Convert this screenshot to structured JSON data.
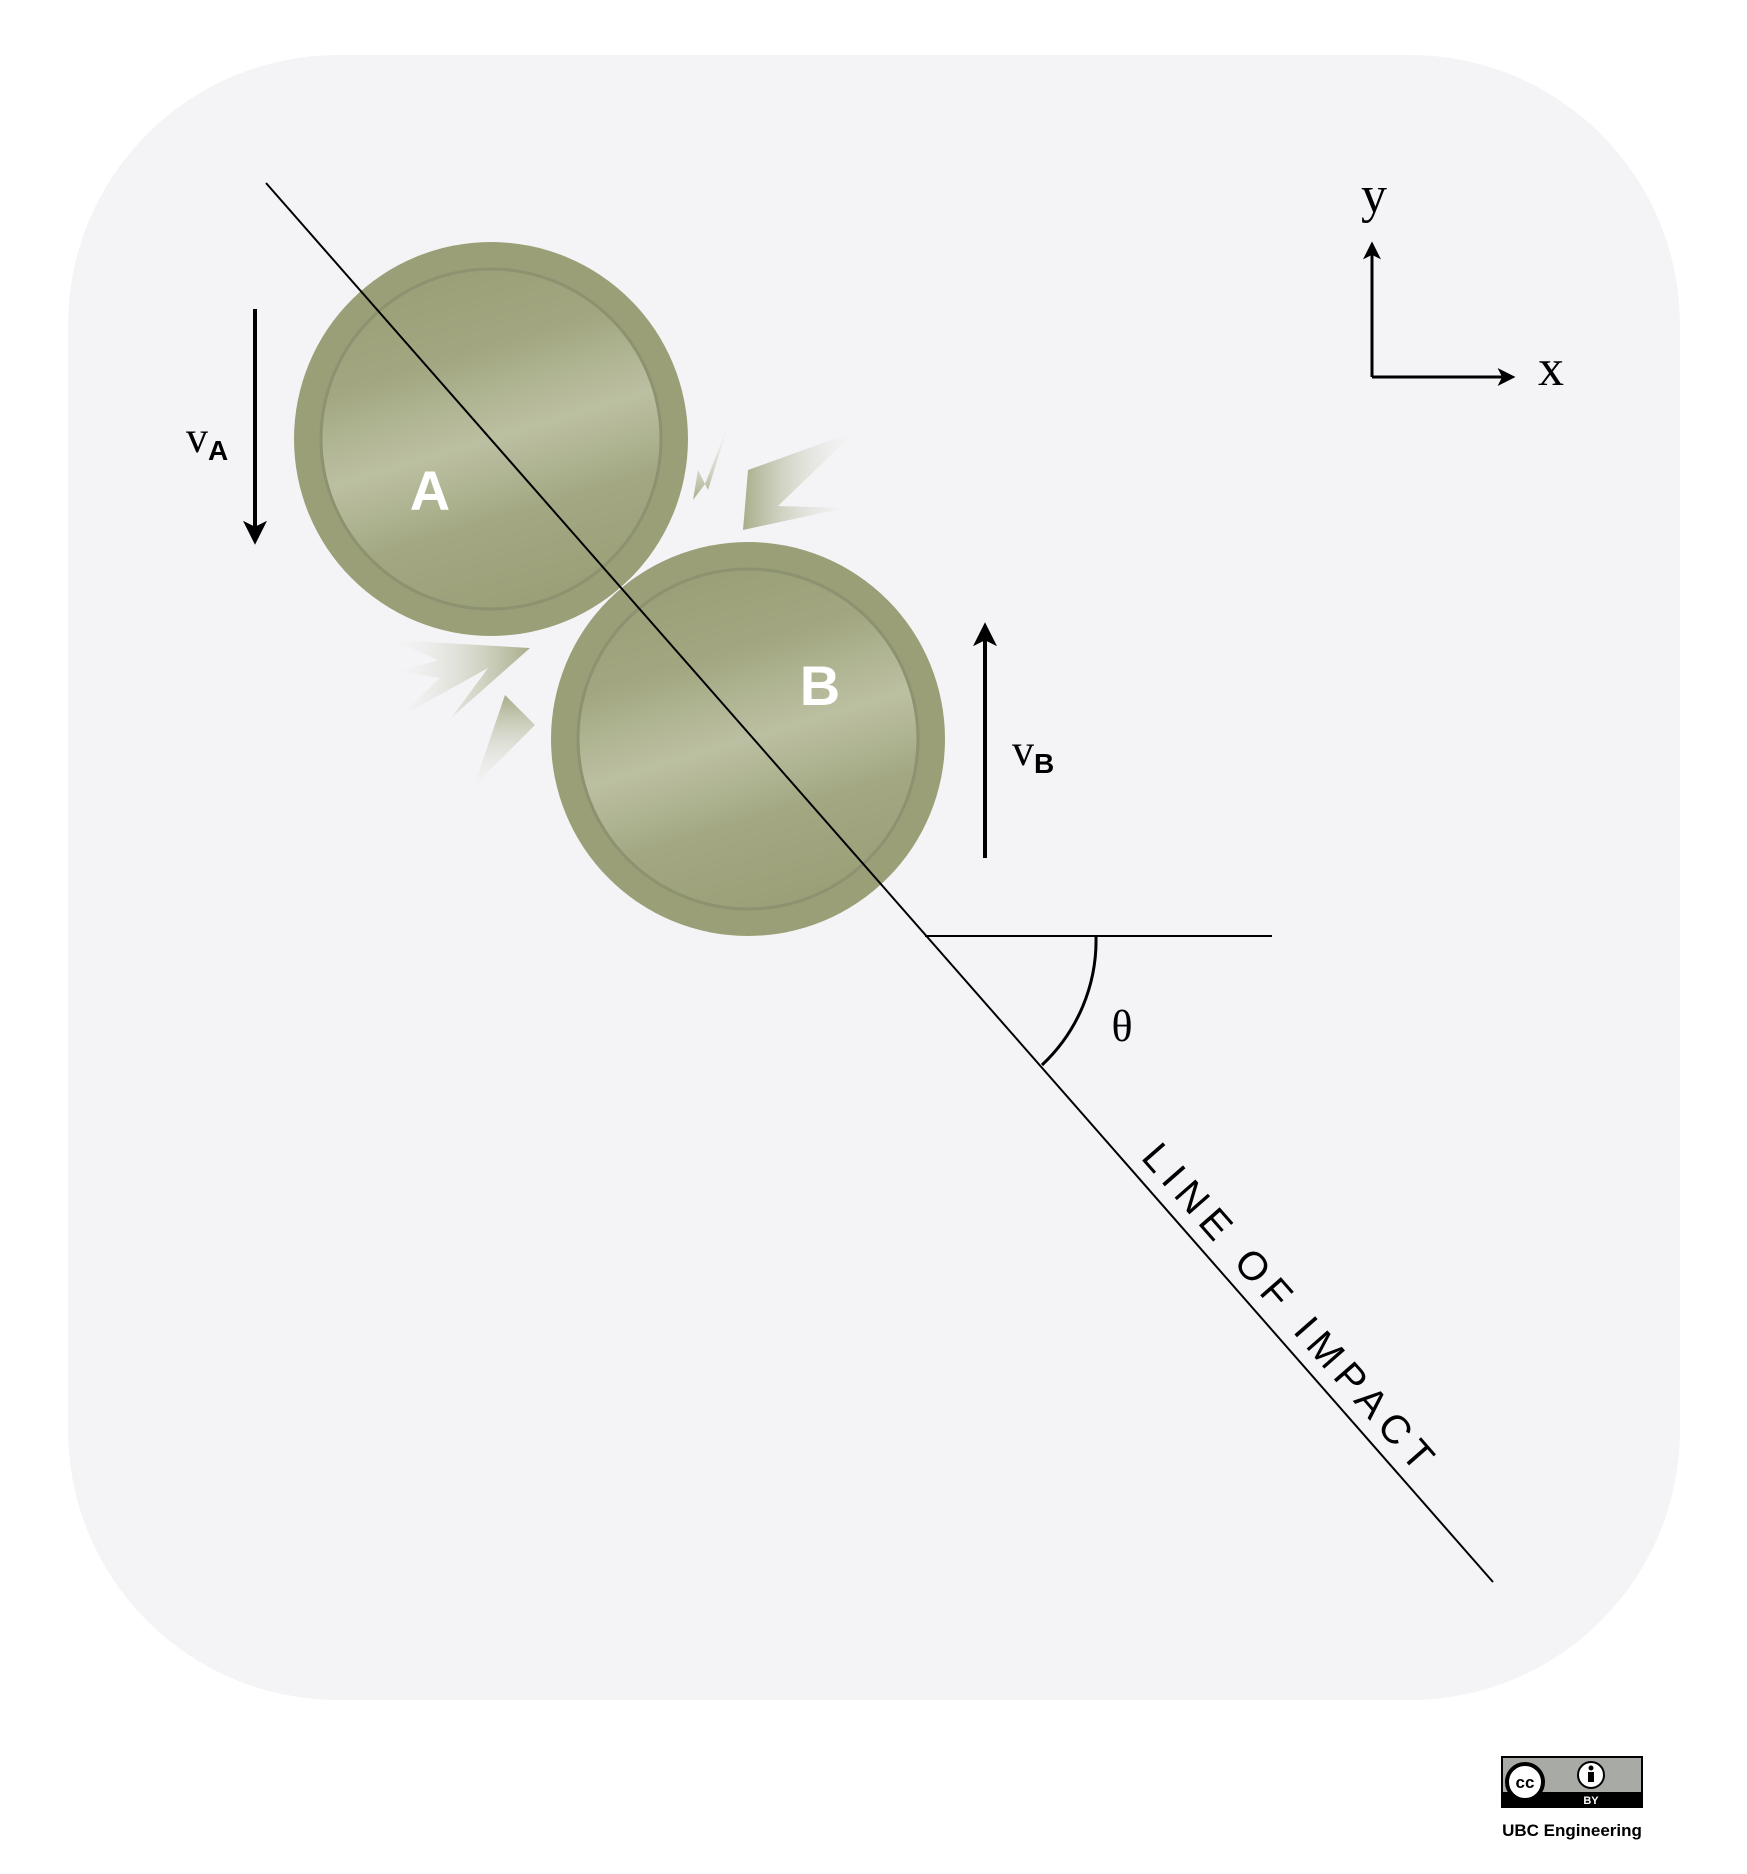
{
  "diagram": {
    "labels": {
      "ball_a": "A",
      "ball_b": "B",
      "velocity_a_symbol": "v",
      "velocity_a_subscript": "A",
      "velocity_b_symbol": "v",
      "velocity_b_subscript": "B",
      "angle": "θ",
      "line_of_impact": "LINE OF IMPACT",
      "axis_x": "x",
      "axis_y": "y"
    },
    "colors": {
      "panel_background": "#f4f4f6",
      "ball_fill": "#9a9f77",
      "ball_highlight": "#bcc0a2",
      "ball_label": "#ffffff",
      "ink": "#000000"
    }
  },
  "license": {
    "badge_cc": "cc",
    "badge_by": "BY",
    "credit": "UBC Engineering"
  }
}
